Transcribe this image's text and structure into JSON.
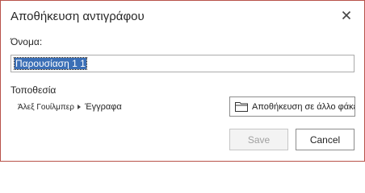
{
  "dialog": {
    "title": "Αποθήκευση αντιγράφου",
    "close_icon": "close-icon",
    "accent_border": "#b8524a"
  },
  "name_field": {
    "label": "Όνομα:",
    "value": "Παρουσίαση 1 1",
    "selected": true
  },
  "location": {
    "label": "Τοποθεσία",
    "breadcrumb": [
      "Άλεξ Γουίλμπερ",
      "Έγγραφα"
    ],
    "separator_icon": "chevron-right-icon"
  },
  "save_elsewhere_button": {
    "icon": "folder-icon",
    "label": "Αποθήκευση σε άλλο φάκελο"
  },
  "buttons": {
    "save": "Save",
    "save_disabled": true,
    "cancel": "Cancel"
  }
}
